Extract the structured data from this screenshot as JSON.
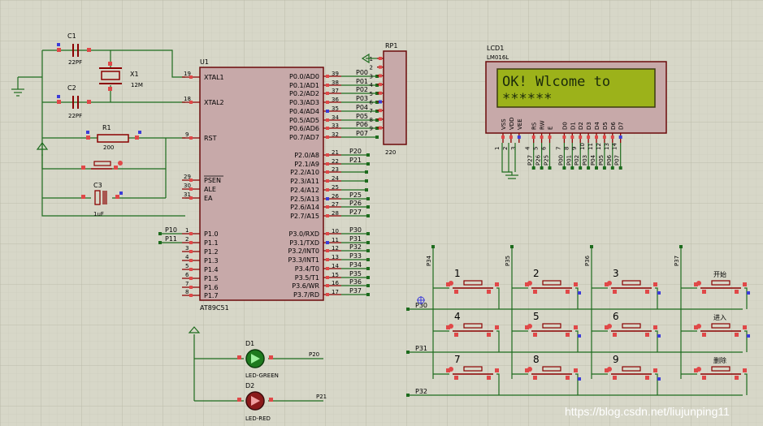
{
  "components": {
    "c1": {
      "ref": "C1",
      "value": "22PF"
    },
    "c2": {
      "ref": "C2",
      "value": "22PF"
    },
    "c3": {
      "ref": "C3",
      "value": "1uF"
    },
    "x1": {
      "ref": "X1",
      "value": "12M"
    },
    "r1": {
      "ref": "R1",
      "value": "200"
    },
    "u1": {
      "ref": "U1",
      "part": "AT89C51"
    },
    "rp1": {
      "ref": "RP1",
      "value": "220"
    },
    "lcd1": {
      "ref": "LCD1",
      "part": "LM016L",
      "line1": "OK! Wlcome to",
      "line2": "******"
    },
    "d1": {
      "ref": "D1",
      "part": "LED-GREEN",
      "net": "P20"
    },
    "d2": {
      "ref": "D2",
      "part": "LED-RED",
      "net": "P21"
    }
  },
  "mcu_left_pins": [
    {
      "num": "19",
      "name": "XTAL1"
    },
    {
      "num": "18",
      "name": "XTAL2"
    },
    {
      "num": "9",
      "name": "RST"
    },
    {
      "num": "29",
      "name": "PSEN"
    },
    {
      "num": "30",
      "name": "ALE"
    },
    {
      "num": "31",
      "name": "EA"
    },
    {
      "num": "1",
      "name": "P1.0",
      "net": "P10"
    },
    {
      "num": "2",
      "name": "P1.1",
      "net": "P11"
    },
    {
      "num": "3",
      "name": "P1.2"
    },
    {
      "num": "4",
      "name": "P1.3"
    },
    {
      "num": "5",
      "name": "P1.4"
    },
    {
      "num": "6",
      "name": "P1.5"
    },
    {
      "num": "7",
      "name": "P1.6"
    },
    {
      "num": "8",
      "name": "P1.7"
    }
  ],
  "mcu_right_pins": [
    {
      "num": "39",
      "name": "P0.0/AD0",
      "net": "P00"
    },
    {
      "num": "38",
      "name": "P0.1/AD1",
      "net": "P01"
    },
    {
      "num": "37",
      "name": "P0.2/AD2",
      "net": "P02"
    },
    {
      "num": "36",
      "name": "P0.3/AD3",
      "net": "P03"
    },
    {
      "num": "35",
      "name": "P0.4/AD4",
      "net": "P04"
    },
    {
      "num": "34",
      "name": "P0.5/AD5",
      "net": "P05"
    },
    {
      "num": "33",
      "name": "P0.6/AD6",
      "net": "P06"
    },
    {
      "num": "32",
      "name": "P0.7/AD7",
      "net": "P07"
    },
    {
      "num": "21",
      "name": "P2.0/A8",
      "net": "P20"
    },
    {
      "num": "22",
      "name": "P2.1/A9",
      "net": "P21"
    },
    {
      "num": "23",
      "name": "P2.2/A10"
    },
    {
      "num": "24",
      "name": "P2.3/A11"
    },
    {
      "num": "25",
      "name": "P2.4/A12"
    },
    {
      "num": "26",
      "name": "P2.5/A13",
      "net": "P25"
    },
    {
      "num": "27",
      "name": "P2.6/A14",
      "net": "P26"
    },
    {
      "num": "28",
      "name": "P2.7/A15",
      "net": "P27"
    },
    {
      "num": "10",
      "name": "P3.0/RXD",
      "net": "P30"
    },
    {
      "num": "11",
      "name": "P3.1/TXD",
      "net": "P31"
    },
    {
      "num": "12",
      "name": "P3.2/INT0",
      "net": "P32"
    },
    {
      "num": "13",
      "name": "P3.3/INT1",
      "net": "P33"
    },
    {
      "num": "14",
      "name": "P3.4/T0",
      "net": "P34"
    },
    {
      "num": "15",
      "name": "P3.5/T1",
      "net": "P35"
    },
    {
      "num": "16",
      "name": "P3.6/WR",
      "net": "P36"
    },
    {
      "num": "17",
      "name": "P3.7/RD",
      "net": "P37"
    }
  ],
  "rp1_pins": [
    "1",
    "2",
    "3",
    "4",
    "5",
    "6",
    "7",
    "8",
    "9"
  ],
  "lcd_pins": [
    {
      "name": "VSS",
      "num": "1"
    },
    {
      "name": "VDD",
      "num": "2"
    },
    {
      "name": "VEE",
      "num": "3"
    },
    {
      "name": "RS",
      "num": "4",
      "net": "P27"
    },
    {
      "name": "RW",
      "num": "5",
      "net": "P26"
    },
    {
      "name": "E",
      "num": "6",
      "net": "P25"
    },
    {
      "name": "D0",
      "num": "7",
      "net": "P00"
    },
    {
      "name": "D1",
      "num": "8",
      "net": "P01"
    },
    {
      "name": "D2",
      "num": "9",
      "net": "P02"
    },
    {
      "name": "D3",
      "num": "10",
      "net": "P03"
    },
    {
      "name": "D4",
      "num": "11",
      "net": "P04"
    },
    {
      "name": "D5",
      "num": "12",
      "net": "P05"
    },
    {
      "name": "D6",
      "num": "13",
      "net": "P06"
    },
    {
      "name": "D7",
      "num": "14",
      "net": "P07"
    }
  ],
  "keypad": {
    "col_nets": [
      "P34",
      "P35",
      "P36",
      "P37"
    ],
    "row_nets": [
      "P30",
      "P31",
      "P32"
    ],
    "keys": [
      "1",
      "2",
      "3",
      "开始",
      "4",
      "5",
      "6",
      "进入",
      "7",
      "8",
      "9",
      "删除"
    ]
  },
  "watermark": "https://blog.csdn.net/liujunping11"
}
